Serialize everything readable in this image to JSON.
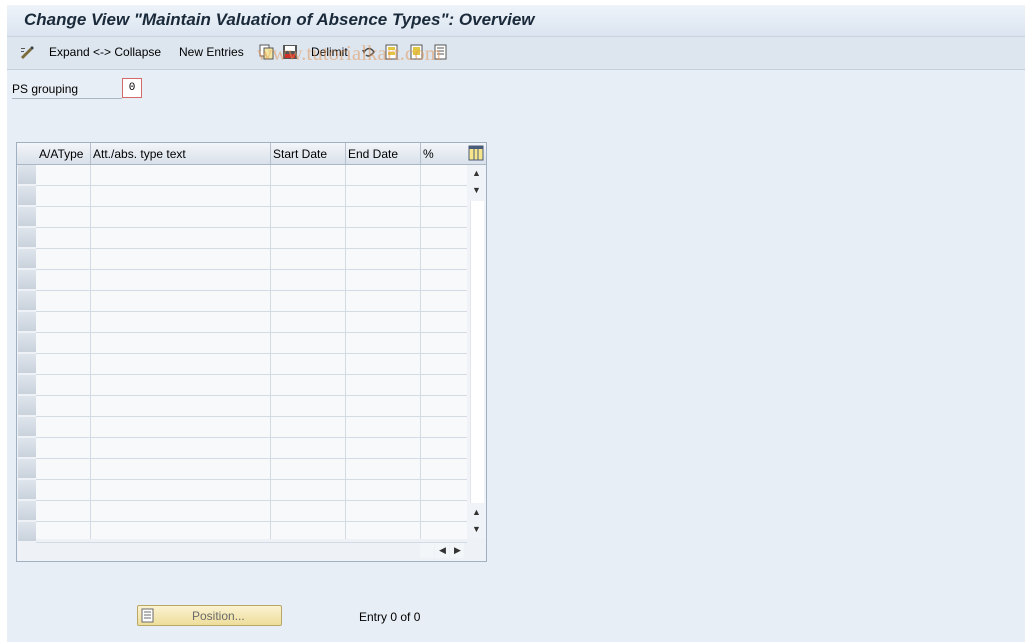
{
  "title": "Change View \"Maintain Valuation of Absence Types\": Overview",
  "toolbar": {
    "expand_collapse_label": "Expand <-> Collapse",
    "new_entries_label": "New Entries",
    "delimit_label": "Delimit",
    "watermark": "www.tutorialkart.com",
    "icons": [
      "display-change-icon",
      "copy-icon",
      "save-icon",
      "delimit-icon",
      "undo-icon",
      "select-all-icon",
      "select-block-icon",
      "deselect-all-icon"
    ]
  },
  "ps_grouping": {
    "label": "PS grouping",
    "value": "0"
  },
  "table": {
    "columns": [
      "A/AType",
      "Att./abs. type text",
      "Start Date",
      "End Date",
      "%"
    ],
    "row_count": 18,
    "rows": []
  },
  "footer": {
    "position_button_label": "Position...",
    "entry_text": "Entry 0 of 0"
  },
  "colors": {
    "background": "#e8eef5",
    "title_text": "#1a2a3a",
    "button_yellow": "#eedd9a"
  }
}
